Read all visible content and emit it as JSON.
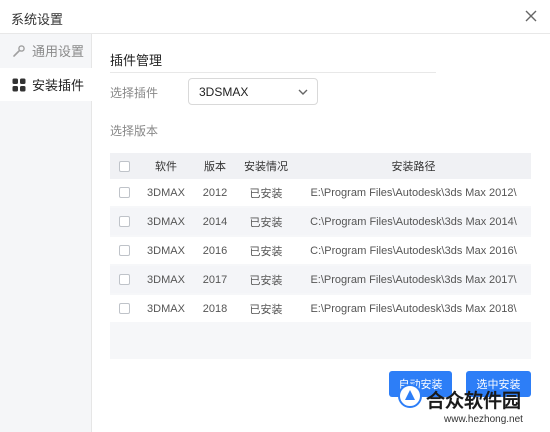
{
  "window": {
    "title": "系统设置"
  },
  "sidebar": {
    "items": [
      {
        "label": "通用设置",
        "icon": "wrench-icon"
      },
      {
        "label": "安装插件",
        "icon": "apps-grid-icon"
      }
    ]
  },
  "main": {
    "section_title": "插件管理",
    "plugin_label": "选择插件",
    "plugin_value": "3DSMAX",
    "version_label": "选择版本"
  },
  "table": {
    "headers": [
      "软件",
      "版本",
      "安装情况",
      "安装路径"
    ],
    "rows": [
      {
        "software": "3DMAX",
        "version": "2012",
        "status": "已安装",
        "path": "E:\\Program Files\\Autodesk\\3ds Max 2012\\"
      },
      {
        "software": "3DMAX",
        "version": "2014",
        "status": "已安装",
        "path": "C:\\Program Files\\Autodesk\\3ds Max 2014\\"
      },
      {
        "software": "3DMAX",
        "version": "2016",
        "status": "已安装",
        "path": "C:\\Program Files\\Autodesk\\3ds Max 2016\\"
      },
      {
        "software": "3DMAX",
        "version": "2017",
        "status": "已安装",
        "path": "E:\\Program Files\\Autodesk\\3ds Max 2017\\"
      },
      {
        "software": "3DMAX",
        "version": "2018",
        "status": "已安装",
        "path": "E:\\Program Files\\Autodesk\\3ds Max 2018\\"
      }
    ]
  },
  "buttons": {
    "auto_install": "自动安装",
    "install_selected": "选中安装"
  },
  "watermark": {
    "name": "合众软件园",
    "url": "www.hezhong.net"
  },
  "colors": {
    "accent": "#2d7ef7",
    "sidebar_bg": "#f5f6f8",
    "table_header_bg": "#f0f1f4"
  }
}
